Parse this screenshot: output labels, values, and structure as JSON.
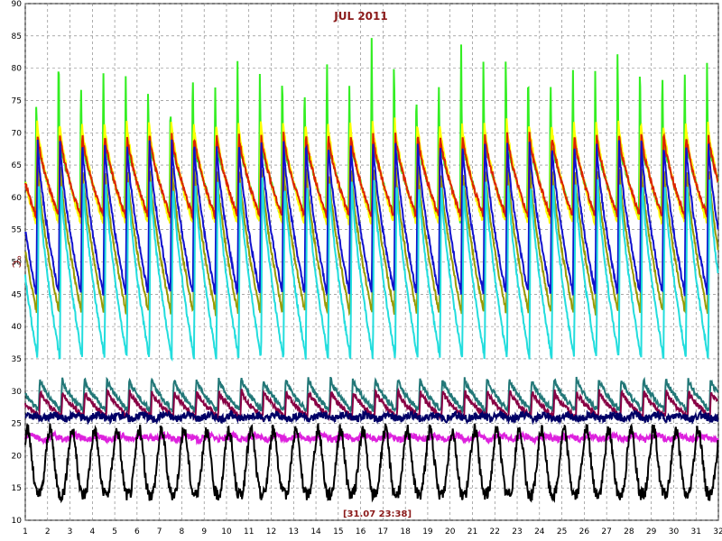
{
  "chart_data": {
    "type": "line",
    "title": "JUL 2011",
    "ylabel": "°C",
    "timestamp": "[31.07 23:38]",
    "xlim": [
      1,
      32
    ],
    "ylim": [
      10,
      90
    ],
    "x_ticks": [
      1,
      2,
      3,
      4,
      5,
      6,
      7,
      8,
      9,
      10,
      11,
      12,
      13,
      14,
      15,
      16,
      17,
      18,
      19,
      20,
      21,
      22,
      23,
      24,
      25,
      26,
      27,
      28,
      29,
      30,
      31,
      32
    ],
    "y_ticks": [
      10,
      15,
      20,
      25,
      30,
      35,
      40,
      45,
      50,
      55,
      60,
      65,
      70,
      75,
      80,
      85,
      90
    ],
    "grid": true,
    "series": [
      {
        "color": "#33ee22",
        "kind": "spike",
        "period": 1.0,
        "phase": 0.45,
        "peaks": [
          76,
          85,
          80,
          81,
          79,
          77,
          75,
          82,
          79,
          82,
          80,
          81,
          79,
          84,
          78,
          85,
          83,
          78,
          80,
          86,
          81,
          83,
          82,
          80,
          82,
          80,
          84,
          83,
          82,
          81,
          82
        ],
        "base": 55,
        "decay_to": 57,
        "width": 0.35
      },
      {
        "color": "#ffff00",
        "kind": "saw",
        "period": 1.0,
        "phase": 0.48,
        "peak": 72,
        "trough": 56
      },
      {
        "color": "#dd2200",
        "kind": "saw",
        "period": 1.0,
        "phase": 0.5,
        "peak": 70,
        "trough": 57
      },
      {
        "color": "#999900",
        "kind": "saw",
        "period": 1.0,
        "phase": 0.52,
        "peak": 65,
        "trough": 42
      },
      {
        "color": "#1111cc",
        "kind": "saw",
        "period": 1.0,
        "phase": 0.5,
        "peak": 69,
        "trough": 45
      },
      {
        "color": "#22dddd",
        "kind": "saw",
        "period": 1.0,
        "phase": 0.55,
        "peak": 63,
        "trough": 35
      },
      {
        "color": "#227777",
        "kind": "saw",
        "period": 1.0,
        "phase": 0.6,
        "peak": 32,
        "trough": 27
      },
      {
        "color": "#880044",
        "kind": "saw",
        "period": 1.0,
        "phase": 0.62,
        "peak": 30,
        "trough": 26
      },
      {
        "color": "#000066",
        "kind": "flat",
        "value": 26.0,
        "noise": 0.6
      },
      {
        "color": "#dd22dd",
        "kind": "flat",
        "value": 22.8,
        "noise": 0.5
      },
      {
        "color": "#000000",
        "kind": "wave",
        "period": 1.0,
        "phase": 0.6,
        "peak": 24,
        "trough": 14
      }
    ]
  }
}
